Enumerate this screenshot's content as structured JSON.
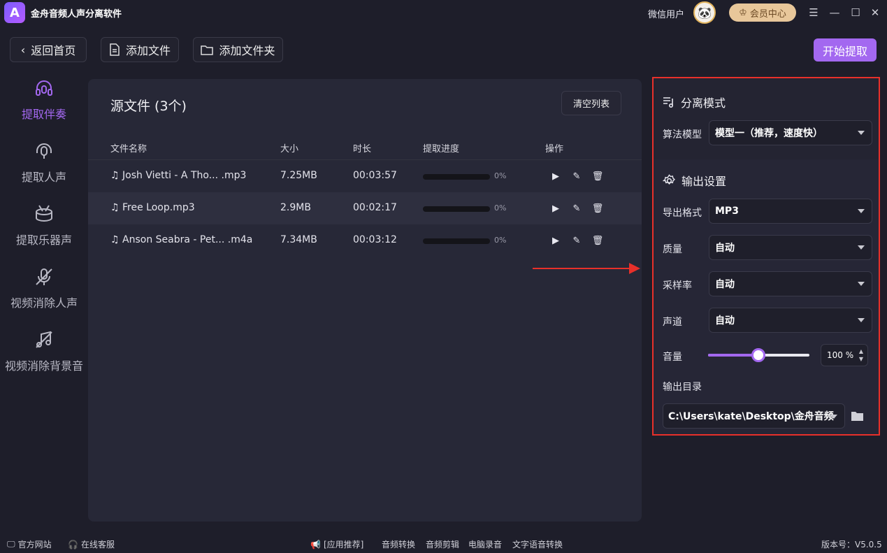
{
  "app": {
    "title": "金舟音频人声分离软件",
    "logo_letter": "A",
    "user_name": "微信用户",
    "vip_label": "会员中心"
  },
  "toolbar": {
    "back_label": "返回首页",
    "add_file_label": "添加文件",
    "add_folder_label": "添加文件夹",
    "start_label": "开始提取"
  },
  "sidebar": {
    "items": [
      {
        "label": "提取伴奏",
        "icon": "headphones-icon"
      },
      {
        "label": "提取人声",
        "icon": "microphone-icon"
      },
      {
        "label": "提取乐器声",
        "icon": "drum-icon"
      },
      {
        "label": "视频消除人声",
        "icon": "mic-off-icon"
      },
      {
        "label": "视频消除背景音",
        "icon": "music-off-icon"
      }
    ]
  },
  "files": {
    "title": "源文件 (3个)",
    "clear_label": "清空列表",
    "columns": {
      "name": "文件名称",
      "size": "大小",
      "duration": "时长",
      "progress": "提取进度",
      "actions": "操作"
    },
    "rows": [
      {
        "name": "Josh Vietti - A Tho... .mp3",
        "size": "7.25MB",
        "duration": "00:03:57",
        "progress": "0%"
      },
      {
        "name": "Free Loop.mp3",
        "size": "2.9MB",
        "duration": "00:02:17",
        "progress": "0%"
      },
      {
        "name": "Anson Seabra - Pet... .m4a",
        "size": "7.34MB",
        "duration": "00:03:12",
        "progress": "0%"
      }
    ]
  },
  "settings": {
    "mode_title": "分离模式",
    "algo_label": "算法模型",
    "algo_value": "模型一（推荐，速度快）",
    "output_title": "输出设置",
    "format_label": "导出格式",
    "format_value": "MP3",
    "quality_label": "质量",
    "quality_value": "自动",
    "samplerate_label": "采样率",
    "samplerate_value": "自动",
    "channel_label": "声道",
    "channel_value": "自动",
    "volume_label": "音量",
    "volume_value": "100 %",
    "dir_label": "输出目录",
    "dir_value": "C:\\Users\\kate\\Desktop\\金舟音频"
  },
  "footer": {
    "website": "官方网站",
    "support": "在线客服",
    "recommend": "[应用推荐]",
    "links": [
      "音频转换",
      "音频剪辑",
      "电脑录音",
      "文字语音转换"
    ],
    "version": "版本号：V5.0.5"
  },
  "colors": {
    "accent": "#a368f0",
    "highlight_border": "#e8302a",
    "arrow": "#e8302a"
  }
}
